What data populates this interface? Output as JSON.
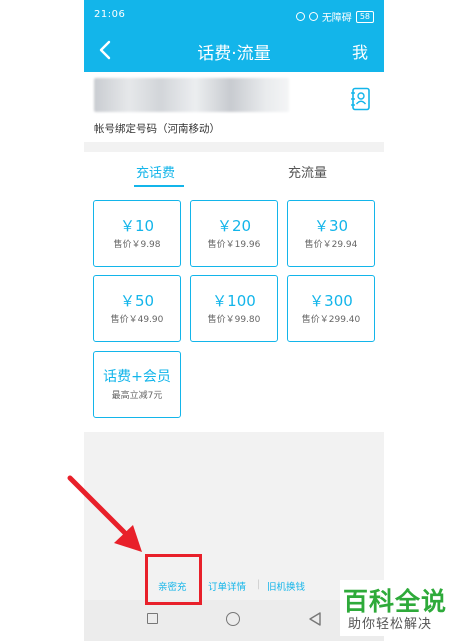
{
  "status_bar": {
    "time": "21:06",
    "carrier_text": "无障碍",
    "battery": "58"
  },
  "nav": {
    "title": "话费·流量",
    "right_label": "我"
  },
  "account": {
    "label": "帐号绑定号码（河南移动）"
  },
  "tabs": [
    {
      "label": "充话费",
      "active": true
    },
    {
      "label": "充流量",
      "active": false
    }
  ],
  "products": [
    {
      "amount": "￥10",
      "price": "售价￥9.98"
    },
    {
      "amount": "￥20",
      "price": "售价￥19.96"
    },
    {
      "amount": "￥30",
      "price": "售价￥29.94"
    },
    {
      "amount": "￥50",
      "price": "售价￥49.90"
    },
    {
      "amount": "￥100",
      "price": "售价￥99.80"
    },
    {
      "amount": "￥300",
      "price": "售价￥299.40"
    },
    {
      "amount": "话费+会员",
      "price": "最高立减7元"
    }
  ],
  "footer_links": [
    "亲密充",
    "订单详情",
    "旧机换钱"
  ],
  "watermark": {
    "title": "百科全说",
    "subtitle": "助你轻松解决"
  },
  "colors": {
    "accent": "#13b5ea",
    "annotation": "#e8202a",
    "watermark_green": "#2eaa3a"
  }
}
